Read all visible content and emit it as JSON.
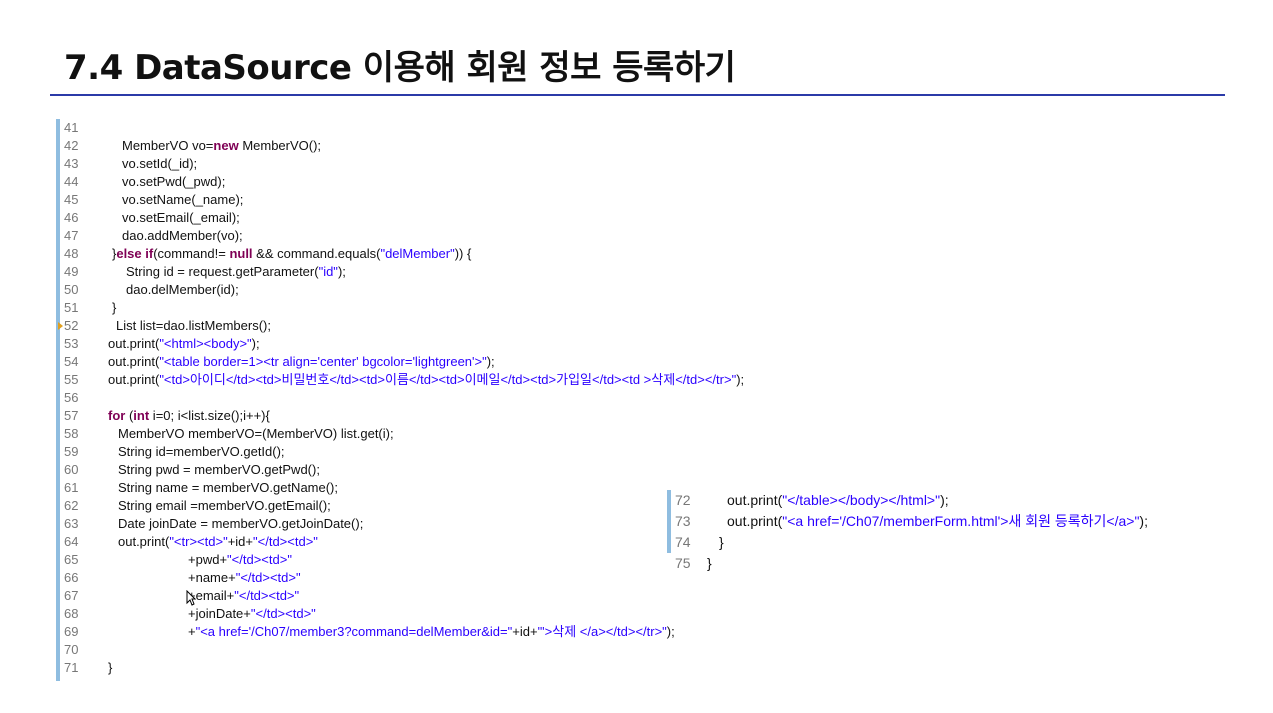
{
  "page": {
    "title": "7.4 DataSource 이용해 회원 정보 등록하기"
  },
  "code_block_1": {
    "lines": [
      {
        "num": "41",
        "indent": 0,
        "tokens": []
      },
      {
        "num": "42",
        "indent": 58,
        "tokens": [
          [
            "",
            "MemberVO vo="
          ],
          [
            "kw",
            "new"
          ],
          [
            "",
            " MemberVO();"
          ]
        ]
      },
      {
        "num": "43",
        "indent": 58,
        "tokens": [
          [
            "",
            "vo.setId(_id);"
          ]
        ]
      },
      {
        "num": "44",
        "indent": 58,
        "tokens": [
          [
            "",
            "vo.setPwd(_pwd);"
          ]
        ]
      },
      {
        "num": "45",
        "indent": 58,
        "tokens": [
          [
            "",
            "vo.setName(_name);"
          ]
        ]
      },
      {
        "num": "46",
        "indent": 58,
        "tokens": [
          [
            "",
            "vo.setEmail(_email);"
          ]
        ]
      },
      {
        "num": "47",
        "indent": 58,
        "tokens": [
          [
            "",
            "dao.addMember(vo);"
          ]
        ]
      },
      {
        "num": "48",
        "indent": 48,
        "tokens": [
          [
            "",
            "}"
          ],
          [
            "kw",
            "else if"
          ],
          [
            "",
            "(command!= "
          ],
          [
            "kw",
            "null"
          ],
          [
            "",
            " && command.equals("
          ],
          [
            "str",
            "\"delMember\""
          ],
          [
            "",
            ")) {"
          ]
        ]
      },
      {
        "num": "49",
        "indent": 62,
        "tokens": [
          [
            "",
            "String id = request.getParameter("
          ],
          [
            "str",
            "\"id\""
          ],
          [
            "",
            ");"
          ]
        ]
      },
      {
        "num": "50",
        "indent": 62,
        "tokens": [
          [
            "",
            "dao.delMember(id);"
          ]
        ]
      },
      {
        "num": "51",
        "indent": 48,
        "tokens": [
          [
            "",
            "}"
          ]
        ]
      },
      {
        "num": "52",
        "indent": 52,
        "tokens": [
          [
            "",
            "List list=dao.listMembers();"
          ]
        ]
      },
      {
        "num": "53",
        "indent": 44,
        "tokens": [
          [
            "",
            "out.print("
          ],
          [
            "str",
            "\"<html><body>\""
          ],
          [
            "",
            ");"
          ]
        ]
      },
      {
        "num": "54",
        "indent": 44,
        "tokens": [
          [
            "",
            "out.print("
          ],
          [
            "str",
            "\"<table border=1><tr align='center' bgcolor='lightgreen'>\""
          ],
          [
            "",
            ");"
          ]
        ]
      },
      {
        "num": "55",
        "indent": 44,
        "tokens": [
          [
            "",
            "out.print("
          ],
          [
            "str",
            "\"<td>아이디</td><td>비밀번호</td><td>이름</td><td>이메일</td><td>가입일</td><td >삭제</td></tr>\""
          ],
          [
            "",
            ");"
          ]
        ]
      },
      {
        "num": "56",
        "indent": 0,
        "tokens": []
      },
      {
        "num": "57",
        "indent": 44,
        "tokens": [
          [
            "kw",
            "for"
          ],
          [
            "",
            " ("
          ],
          [
            "kw",
            "int"
          ],
          [
            "",
            " i=0; i<list.size();i++){"
          ]
        ]
      },
      {
        "num": "58",
        "indent": 54,
        "tokens": [
          [
            "",
            "MemberVO memberVO=(MemberVO) list.get(i);"
          ]
        ]
      },
      {
        "num": "59",
        "indent": 54,
        "tokens": [
          [
            "",
            "String id=memberVO.getId();"
          ]
        ]
      },
      {
        "num": "60",
        "indent": 54,
        "tokens": [
          [
            "",
            "String pwd = memberVO.getPwd();"
          ]
        ]
      },
      {
        "num": "61",
        "indent": 54,
        "tokens": [
          [
            "",
            "String name = memberVO.getName();"
          ]
        ]
      },
      {
        "num": "62",
        "indent": 54,
        "tokens": [
          [
            "",
            "String email =memberVO.getEmail();"
          ]
        ]
      },
      {
        "num": "63",
        "indent": 54,
        "tokens": [
          [
            "",
            "Date joinDate = memberVO.getJoinDate();"
          ]
        ]
      },
      {
        "num": "64",
        "indent": 54,
        "tokens": [
          [
            "",
            "out.print("
          ],
          [
            "str",
            "\"<tr><td>\""
          ],
          [
            "",
            "+id+"
          ],
          [
            "str",
            "\"</td><td>\""
          ]
        ]
      },
      {
        "num": "65",
        "indent": 124,
        "tokens": [
          [
            "",
            "+pwd+"
          ],
          [
            "str",
            "\"</td><td>\""
          ]
        ]
      },
      {
        "num": "66",
        "indent": 124,
        "tokens": [
          [
            "",
            "+name+"
          ],
          [
            "str",
            "\"</td><td>\""
          ]
        ]
      },
      {
        "num": "67",
        "indent": 124,
        "tokens": [
          [
            "",
            "+email+"
          ],
          [
            "str",
            "\"</td><td>\""
          ]
        ]
      },
      {
        "num": "68",
        "indent": 124,
        "tokens": [
          [
            "",
            "+joinDate+"
          ],
          [
            "str",
            "\"</td><td>\""
          ]
        ]
      },
      {
        "num": "69",
        "indent": 124,
        "tokens": [
          [
            "",
            "+"
          ],
          [
            "str",
            "\"<a href='/Ch07/member3?command=delMember&id=\""
          ],
          [
            "",
            "+id+"
          ],
          [
            "str",
            "\"'>삭제 </a></td></tr>\""
          ],
          [
            "",
            ");"
          ]
        ]
      },
      {
        "num": "70",
        "indent": 0,
        "tokens": []
      },
      {
        "num": "71",
        "indent": 44,
        "tokens": [
          [
            "",
            "}"
          ]
        ]
      }
    ]
  },
  "code_block_2": {
    "lines": [
      {
        "num": "72",
        "indent": 52,
        "bar": true,
        "tokens": [
          [
            "",
            "out.print("
          ],
          [
            "str",
            "\"</table></body></html>\""
          ],
          [
            "",
            ");"
          ]
        ]
      },
      {
        "num": "73",
        "indent": 52,
        "bar": true,
        "tokens": [
          [
            "",
            "out.print("
          ],
          [
            "str",
            "\"<a href='/Ch07/memberForm.html'>새 회원 등록하기</a>\""
          ],
          [
            "",
            ");"
          ]
        ]
      },
      {
        "num": "74",
        "indent": 44,
        "bar": true,
        "tokens": [
          [
            "",
            "}"
          ]
        ]
      },
      {
        "num": "75",
        "indent": 32,
        "bar": false,
        "tokens": [
          [
            "",
            "}"
          ]
        ]
      }
    ]
  },
  "colors": {
    "keyword": "#7f0055",
    "string": "#2a00ff",
    "gutter_bar": "#8fbde0",
    "title_rule": "#2b3aa8"
  }
}
